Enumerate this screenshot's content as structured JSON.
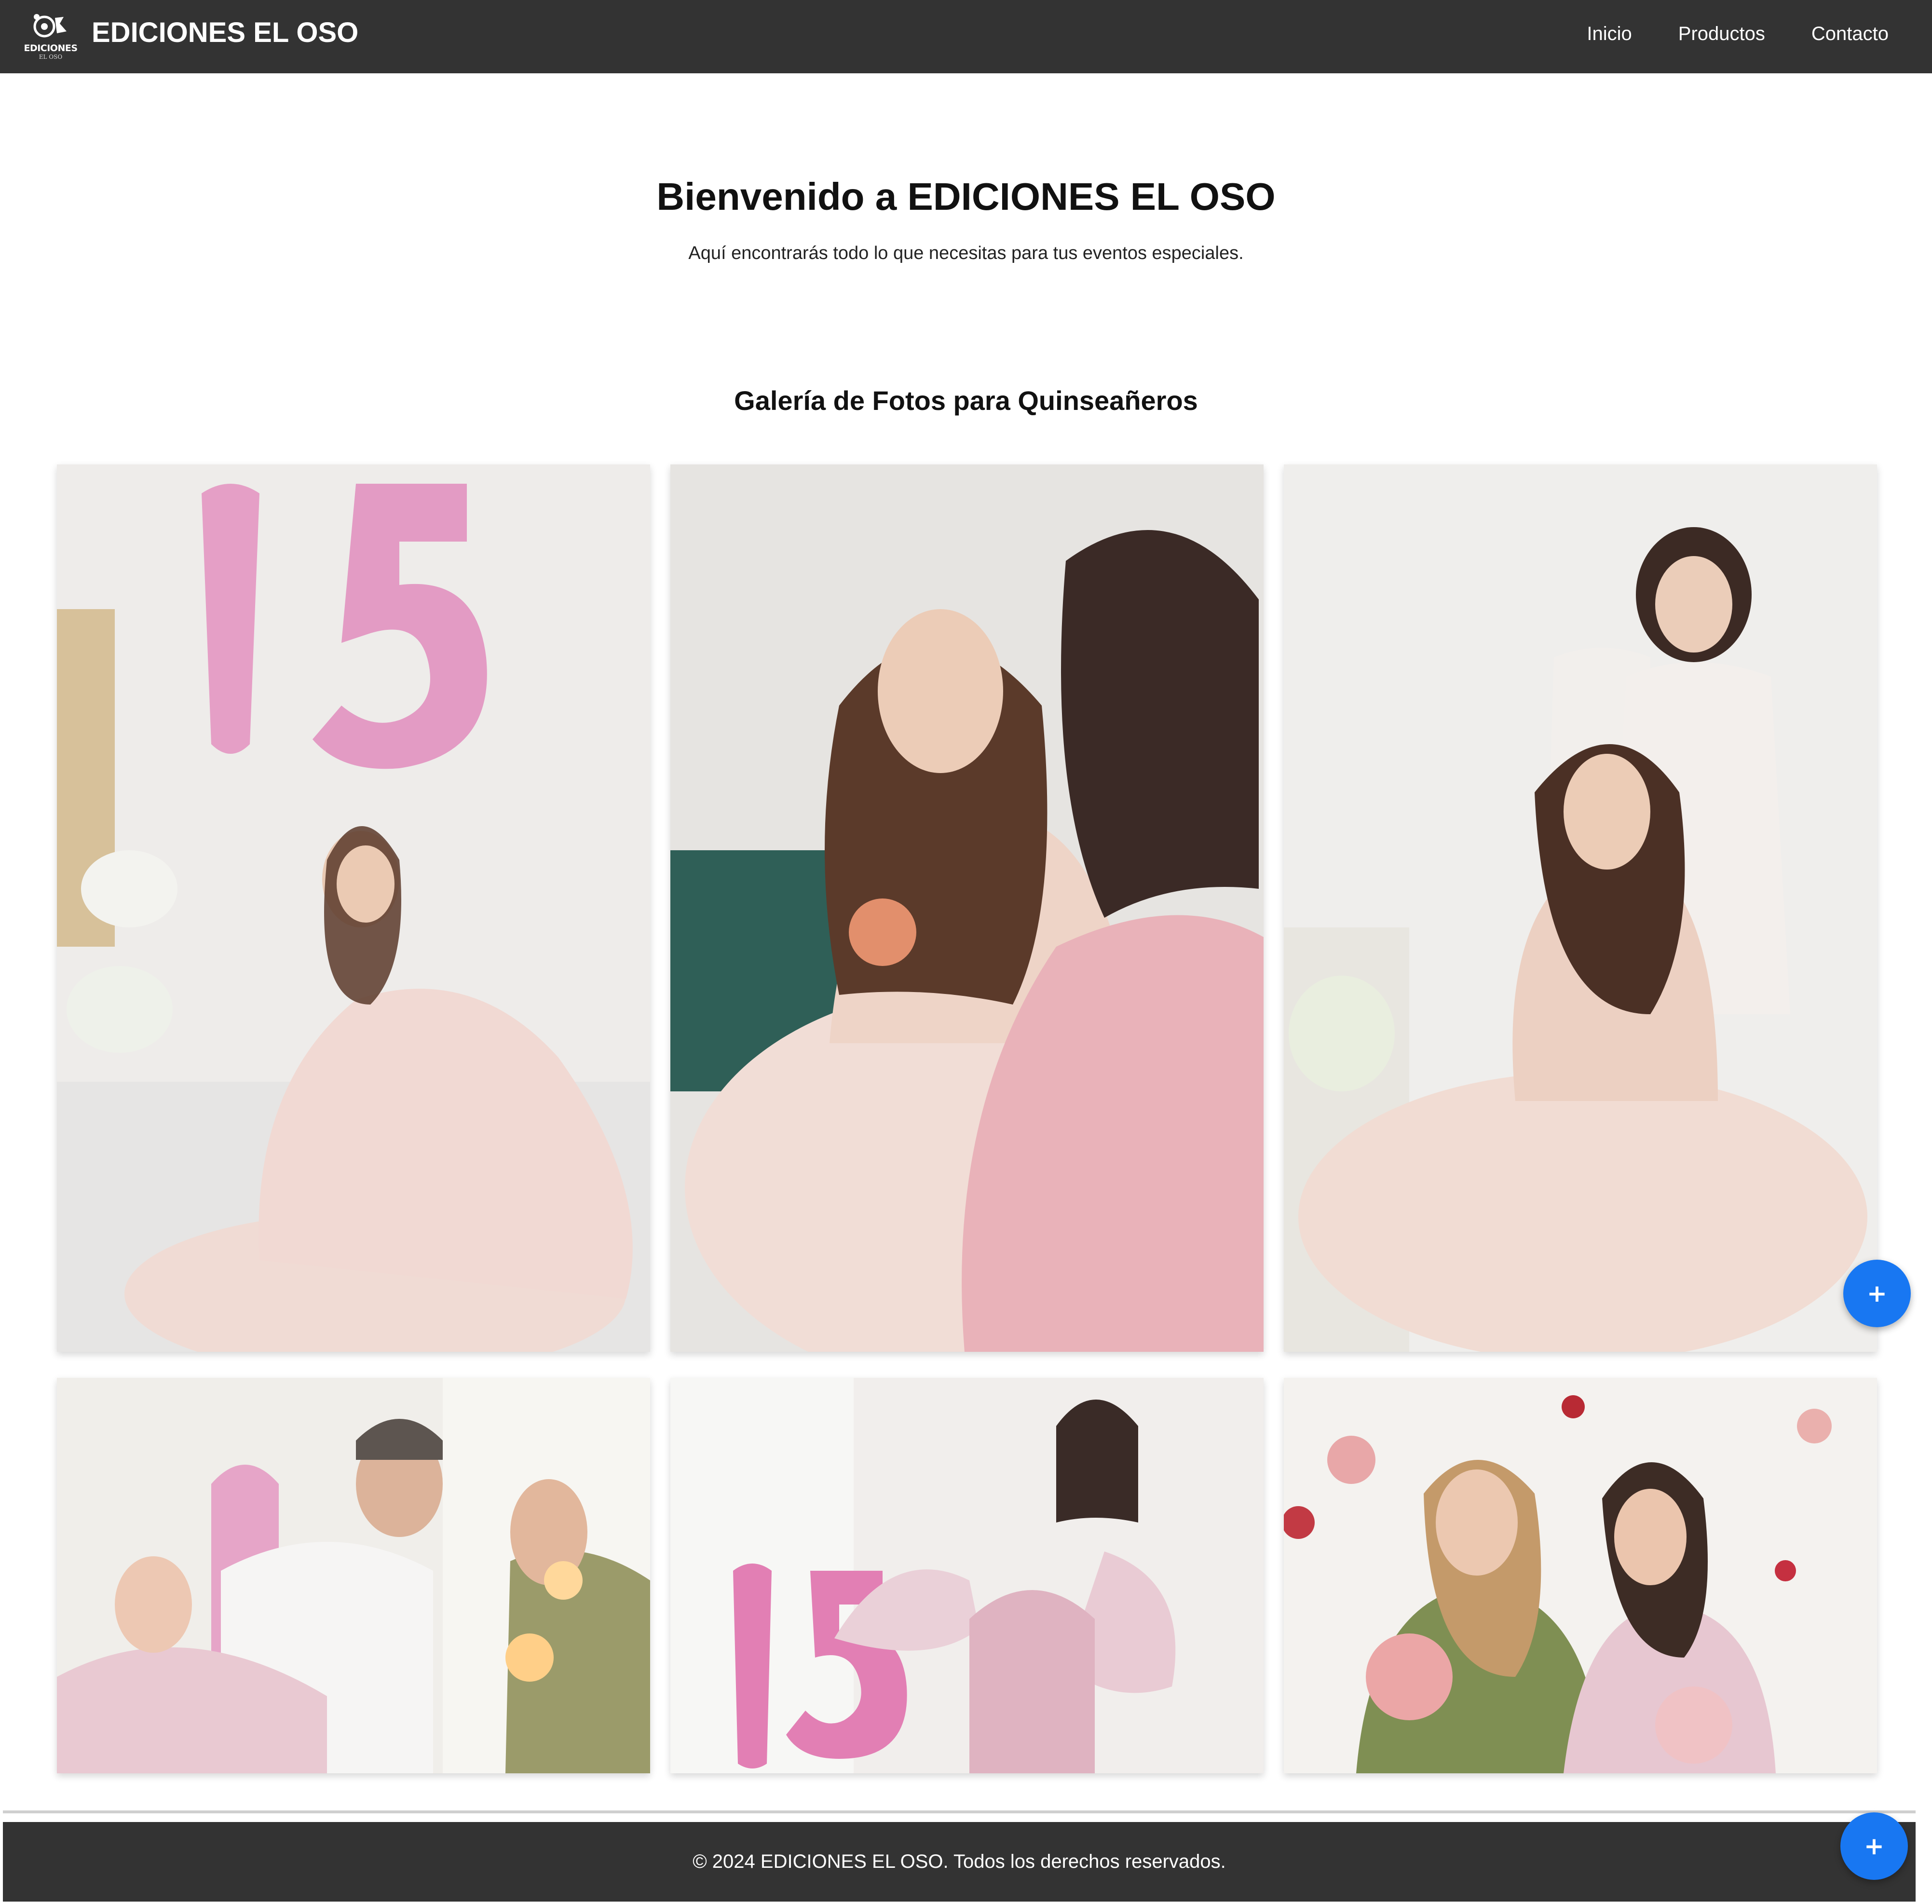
{
  "header": {
    "logo_text": "EDICIONES",
    "logo_subtext": "EL OSO",
    "brand": "EDICIONES EL OSO",
    "nav": [
      {
        "label": "Inicio"
      },
      {
        "label": "Productos"
      },
      {
        "label": "Contacto"
      }
    ]
  },
  "hero": {
    "title": "Bienvenido a EDICIONES EL OSO",
    "subtitle": "Aquí encontrarás todo lo que necesitas para tus eventos especiales."
  },
  "gallery": {
    "title": "Galería de Fotos para Quinseañeros",
    "photos": [
      {
        "icon": "photo-girl-with-15-balloons"
      },
      {
        "icon": "photo-girl-with-cake-and-mother"
      },
      {
        "icon": "photo-girl-with-mother-standing"
      },
      {
        "icon": "photo-girl-with-father-sparklers"
      },
      {
        "icon": "photo-girl-dancing-15-balloons"
      },
      {
        "icon": "photo-girl-with-mother-flowers"
      }
    ]
  },
  "fab": {
    "label": "+"
  },
  "footer": {
    "text": "© 2024 EDICIONES EL OSO. Todos los derechos reservados."
  },
  "colors": {
    "nav_bg": "#333333",
    "accent": "#1877f2",
    "dress_pink": "#f1d9d3",
    "balloon_pink": "#e79bc2"
  }
}
